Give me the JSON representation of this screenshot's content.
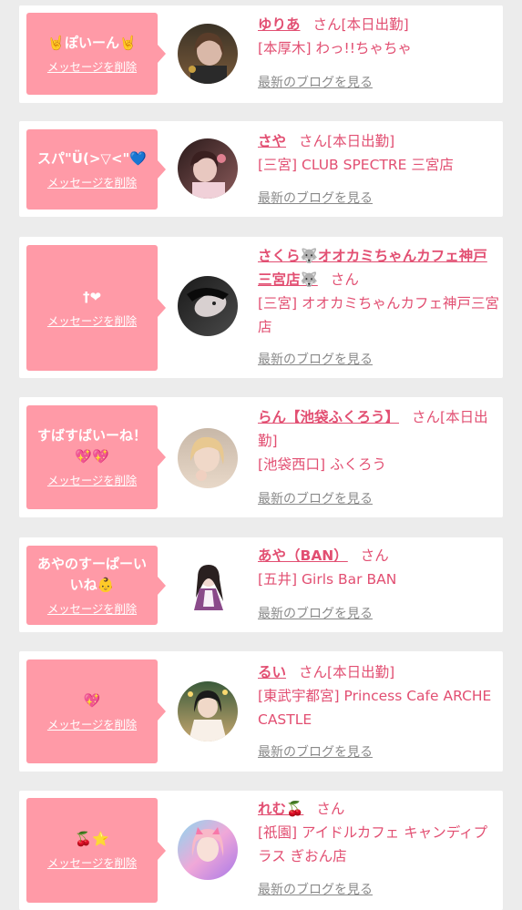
{
  "colors": {
    "accent": "#e24f72",
    "bubble": "#ff9aa7",
    "background": "#ececec",
    "link_gray": "#8a8a8a"
  },
  "entries": [
    {
      "message": "🤘ぽいーん🤘",
      "delete_label": "メッセージを削除",
      "name": "ゆりあ",
      "san": "さん",
      "status": "[本日出勤]",
      "shop": "[本厚木] わっ!!ちゃちゃ",
      "blog_label": "最新のブログを見る"
    },
    {
      "message": "スパ\"Ü(>▽<\"💙",
      "delete_label": "メッセージを削除",
      "name": "さや",
      "san": "さん",
      "status": "[本日出勤]",
      "shop": "[三宮] CLUB SPECTRE 三宮店",
      "blog_label": "最新のブログを見る"
    },
    {
      "message": "†❤",
      "delete_label": "メッセージを削除",
      "name": "さくら🐺オオカミちゃんカフェ神戸三宮店🐺",
      "san": "さん",
      "status": "",
      "shop": "[三宮] オオカミちゃんカフェ神戸三宮店",
      "blog_label": "最新のブログを見る"
    },
    {
      "message": "すばすばいーね！💖💖",
      "delete_label": "メッセージを削除",
      "name": "らん【池袋ふくろう】",
      "san": "さん",
      "status": "[本日出勤]",
      "shop": "[池袋西口] ふくろう",
      "blog_label": "最新のブログを見る"
    },
    {
      "message": "あやのすーぱーいいね👶",
      "delete_label": "メッセージを削除",
      "name": "あや（BAN）",
      "san": "さん",
      "status": "",
      "shop": "[五井] Girls Bar BAN",
      "blog_label": "最新のブログを見る"
    },
    {
      "message": "💖",
      "delete_label": "メッセージを削除",
      "name": "るい",
      "san": "さん",
      "status": "[本日出勤]",
      "shop": "[東武宇都宮] Princess Cafe ARCHE CASTLE",
      "blog_label": "最新のブログを見る"
    },
    {
      "message": "🍒⭐",
      "delete_label": "メッセージを削除",
      "name": "れむ🍒",
      "san": "さん",
      "status": "",
      "shop": "[祇園] アイドルカフェ キャンディプラス ぎおん店",
      "blog_label": "最新のブログを見る"
    }
  ]
}
